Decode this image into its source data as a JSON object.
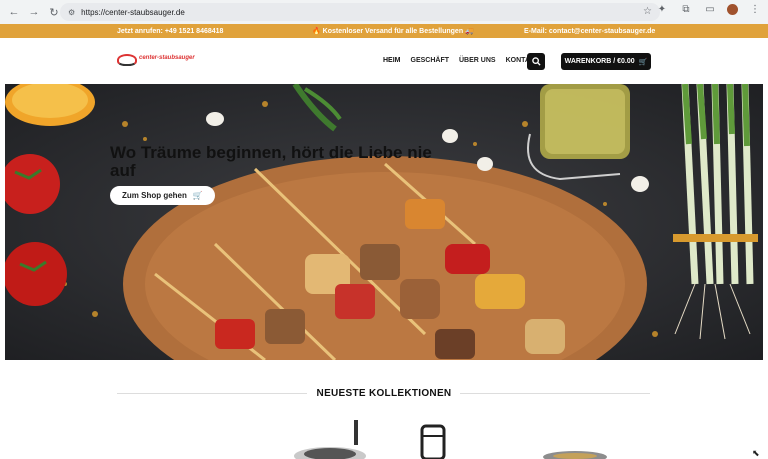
{
  "browser": {
    "url": "https://center-staubsauger.de",
    "icons": [
      "back-icon",
      "forward-icon",
      "reload-icon",
      "site-settings-icon",
      "bookmark-star-icon",
      "extension-icon",
      "puzzle-icon",
      "cast-icon",
      "profile-avatar",
      "menu-kebab-icon"
    ]
  },
  "topbar": {
    "left": "Jetzt anrufen: +49 1521 8468418",
    "middle": "🔥 Kostenloser Versand für alle Bestellungen 🚚",
    "right": "E-Mail: contact@center-staubsauger.de",
    "background": "#e0a23b"
  },
  "header": {
    "logo_text": "center-staubsauger",
    "nav": [
      "HEIM",
      "GESCHÄFT",
      "ÜBER UNS",
      "KONTAKT"
    ],
    "cart_label": "WARENKORB / €0.00"
  },
  "hero": {
    "title": "Wo Träume beginnen, hört die Liebe nie auf",
    "button_label": "Zum Shop gehen"
  },
  "collections": {
    "title": "NEUESTE KOLLEKTIONEN"
  }
}
